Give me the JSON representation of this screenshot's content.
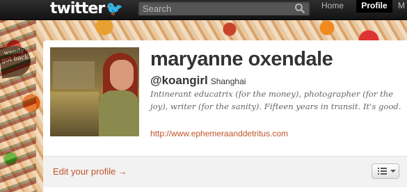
{
  "topbar": {
    "logo_text": "twitter",
    "logo_icon": "bird-icon",
    "search_placeholder": "Search",
    "search_icon": "magnifier-icon",
    "nav": {
      "home": "Home",
      "profile": "Profile"
    }
  },
  "background": {
    "badge_text": "weedy got back"
  },
  "profile": {
    "name": "maryanne oxendale",
    "handle": "@koangirl",
    "location": "Shanghai",
    "bio": "Intinerant educatrix (for the money), photographer (for the joy), writer (for the sanity). Fifteen years in transit. It's good.",
    "url": "http://www.ephemeraanddetritus.com"
  },
  "footer": {
    "edit_profile": "Edit your profile →",
    "menu_icon": "list-icon"
  },
  "colors": {
    "link": "#c0542a",
    "topbar": "#1f1f1f",
    "accent_bird": "#33ccff"
  }
}
